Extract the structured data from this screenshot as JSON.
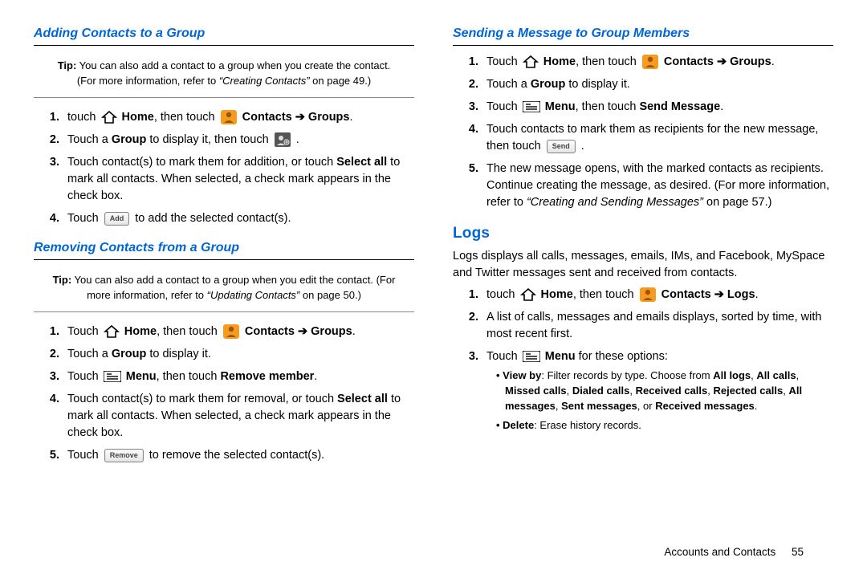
{
  "left": {
    "h1": "Adding Contacts to a Group",
    "tip1_lead": "Tip:",
    "tip1_body": " You can also add a contact to a group when you create the contact. (For more information, refer to ",
    "tip1_ref": "“Creating Contacts”",
    "tip1_tail": " on page 49.)",
    "l1a": "touch ",
    "home": "Home",
    "then_touch": ", then touch ",
    "contacts_groups": "Contacts ➔ Groups",
    "l2a": "Touch a ",
    "group": "Group",
    "l2b": " to display it, then touch ",
    "l3a": "Touch contact(s) to mark them for addition, or touch ",
    "select_all": "Select all",
    "l3b": " to mark all contacts. When selected, a check mark appears in the check box.",
    "l4a": "Touch ",
    "add_btn": "Add",
    "l4b": " to add the selected contact(s).",
    "h2": "Removing Contacts from a Group",
    "tip2_lead": "Tip:",
    "tip2_body": " You can also add a contact to a group when you edit the contact. (For more information, refer to ",
    "tip2_ref": "“Updating Contacts”",
    "tip2_tail": " on page 50.)",
    "r1a": "Touch ",
    "r2a": "Touch a ",
    "r2b": " to display it.",
    "r3a": "Touch ",
    "menu": "Menu",
    "r3b": ", then touch ",
    "remove_member": "Remove member",
    "r4a": "Touch contact(s) to mark them for removal, or touch ",
    "r4b": " to mark all contacts. When selected, a check mark appears in the check box.",
    "r5a": "Touch ",
    "remove_btn": "Remove",
    "r5b": " to remove the selected contact(s)."
  },
  "right": {
    "h1": "Sending a Message to Group Members",
    "s1a": "Touch ",
    "s2a": "Touch a ",
    "s2b": " to display it.",
    "s3a": "Touch ",
    "s3b": ", then touch ",
    "send_message": "Send Message",
    "s4a": "Touch contacts to mark them as recipients for the new message, then touch ",
    "send_btn": "Send",
    "s5a": "The new message opens, with the marked contacts as recipients. Continue creating the message, as desired. (For more information, refer to ",
    "s5_ref": "“Creating and Sending Messages”",
    "s5b": " on page 57.)",
    "h2": "Logs",
    "logs_intro": "Logs displays all calls, messages, emails, IMs, and Facebook, MySpace and Twitter messages sent and received from contacts.",
    "g1a": "touch ",
    "contacts_logs": "Contacts ➔ Logs",
    "g2": "A list of calls, messages and emails displays, sorted by time, with most recent first.",
    "g3a": "Touch ",
    "g3b": " for these options:",
    "b1_lead": "View by",
    "b1_body": ": Filter records by type. Choose from ",
    "opts": [
      "All logs",
      "All calls",
      "Missed calls",
      "Dialed calls",
      "Received calls",
      "Rejected calls",
      "All messages",
      "Sent messages",
      "Received messages"
    ],
    "b2_lead": "Delete",
    "b2_body": ": Erase history records."
  },
  "footer": {
    "section": "Accounts and Contacts",
    "page": "55"
  }
}
